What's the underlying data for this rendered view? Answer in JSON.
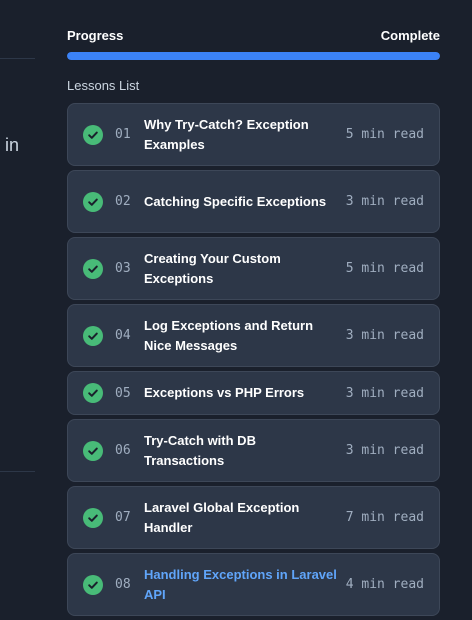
{
  "left": {
    "partial_text": "in"
  },
  "progress": {
    "label": "Progress",
    "status": "Complete",
    "percent": 100,
    "fill_color": "#3b82f6"
  },
  "lessons_section": {
    "title": "Lessons List"
  },
  "lessons": [
    {
      "number": "01",
      "title": "Why Try-Catch? Exception Examples",
      "read_time": "5 min read",
      "completed": true
    },
    {
      "number": "02",
      "title": "Catching Specific Exceptions",
      "read_time": "3 min read",
      "completed": true
    },
    {
      "number": "03",
      "title": "Creating Your Custom Exceptions",
      "read_time": "5 min read",
      "completed": true
    },
    {
      "number": "04",
      "title": "Log Exceptions and Return Nice Messages",
      "read_time": "3 min read",
      "completed": true
    },
    {
      "number": "05",
      "title": "Exceptions vs PHP Errors",
      "read_time": "3 min read",
      "completed": true
    },
    {
      "number": "06",
      "title": "Try-Catch with DB Transactions",
      "read_time": "3 min read",
      "completed": true
    },
    {
      "number": "07",
      "title": "Laravel Global Exception Handler",
      "read_time": "7 min read",
      "completed": true
    },
    {
      "number": "08",
      "title": "Handling Exceptions in Laravel API",
      "read_time": "4 min read",
      "completed": true,
      "active": true
    }
  ],
  "colors": {
    "background": "#1a202c",
    "card": "#2d3748",
    "check": "#48bb78",
    "active_link": "#60a5fa"
  },
  "icons": {
    "lesson_status": "check-circle-icon"
  }
}
